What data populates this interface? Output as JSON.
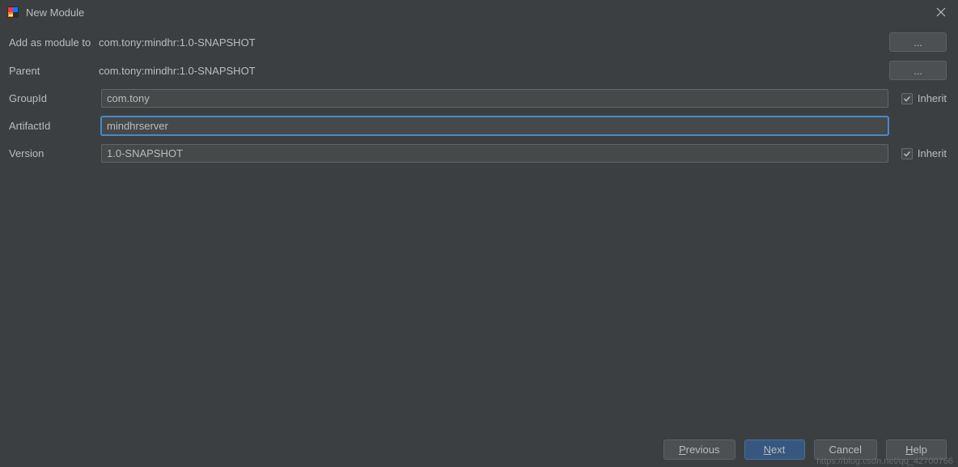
{
  "titlebar": {
    "title": "New Module"
  },
  "form": {
    "add_as_module_to": {
      "label": "Add as module to",
      "value": "com.tony:mindhr:1.0-SNAPSHOT",
      "browse": "..."
    },
    "parent": {
      "label": "Parent",
      "value": "com.tony:mindhr:1.0-SNAPSHOT",
      "browse": "..."
    },
    "groupid": {
      "label": "GroupId",
      "value": "com.tony",
      "inherit_label": "Inherit",
      "inherit_checked": true
    },
    "artifactid": {
      "label": "ArtifactId",
      "value": "mindhrserver"
    },
    "version": {
      "label": "Version",
      "value": "1.0-SNAPSHOT",
      "inherit_label": "Inherit",
      "inherit_checked": true
    }
  },
  "footer": {
    "previous": "Previous",
    "previous_u": "P",
    "previous_rest": "revious",
    "next": "Next",
    "next_u": "N",
    "next_rest": "ext",
    "cancel": "Cancel",
    "help": "Help",
    "help_u": "H",
    "help_rest": "elp"
  },
  "watermark": "https://blog.csdn.net/qq_42700766"
}
